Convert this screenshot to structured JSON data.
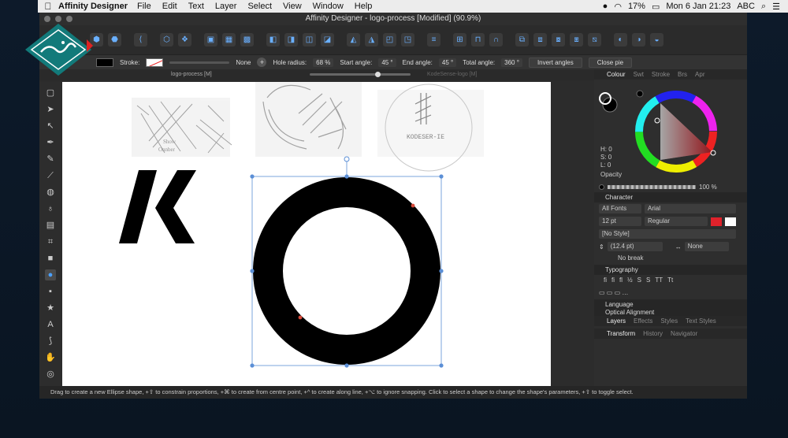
{
  "menubar": {
    "apple": "",
    "app_name": "Affinity Designer",
    "items": [
      "File",
      "Edit",
      "Text",
      "Layer",
      "Select",
      "View",
      "Window",
      "Help"
    ],
    "battery": "17%",
    "datetime": "Mon 6 Jan  21:23",
    "input_source": "ABC"
  },
  "window": {
    "title": "Affinity Designer - logo-process [Modified] (90.9%)"
  },
  "context_toolbar": {
    "stroke_label": "Stroke:",
    "stroke_value": "None",
    "hole_radius_label": "Hole radius:",
    "hole_radius_value": "68 %",
    "start_angle_label": "Start angle:",
    "start_angle_value": "45 °",
    "end_angle_label": "End angle:",
    "end_angle_value": "45 °",
    "total_angle_label": "Total angle:",
    "total_angle_value": "360 °",
    "invert_angles": "Invert angles",
    "close_pie": "Close pie"
  },
  "doc_tabs": {
    "tab1": "logo-process [M]",
    "tab2": "KodeSense-logo [M]"
  },
  "panel": {
    "top_tabs": [
      "Colour",
      "Swt",
      "Stroke",
      "Brs",
      "Apr"
    ],
    "hsl": [
      "H: 0",
      "S: 0",
      "L: 0"
    ],
    "opacity_label": "Opacity",
    "opacity_value": "100 %",
    "character_title": "Character",
    "all_fonts": "All Fonts",
    "font_family": "Arial",
    "font_size": "12 pt",
    "font_style": "Regular",
    "text_style": "[No Style]",
    "leading": "(12.4 pt)",
    "kerning": "None",
    "no_break": "No break",
    "typography_title": "Typography",
    "typography_glyphs": [
      "fi",
      "ﬁ",
      "ﬂ",
      "½",
      "S",
      "S",
      "TT",
      "Tt"
    ],
    "language_title": "Language",
    "optical_title": "Optical Alignment",
    "bottom_tabs1": [
      "Layers",
      "Effects",
      "Styles",
      "Text Styles"
    ],
    "bottom_tabs2": [
      "Transform",
      "History",
      "Navigator"
    ]
  },
  "sketch_texts": {
    "kodesense": "KODESER-IE",
    "show": "Show",
    "show2": "Onnber"
  },
  "status": {
    "text": "Drag to create a new Ellipse shape, +⇧ to constrain proportions, +⌘ to create from centre point, +^ to create along line, +⌥ to ignore snapping. Click to select a shape to change the shape's parameters, +⇧ to toggle select."
  },
  "colors": {
    "accent_blue": "#4aa0ff",
    "selection": "#5b8fd6",
    "fill_swatch": "#e0222b"
  }
}
